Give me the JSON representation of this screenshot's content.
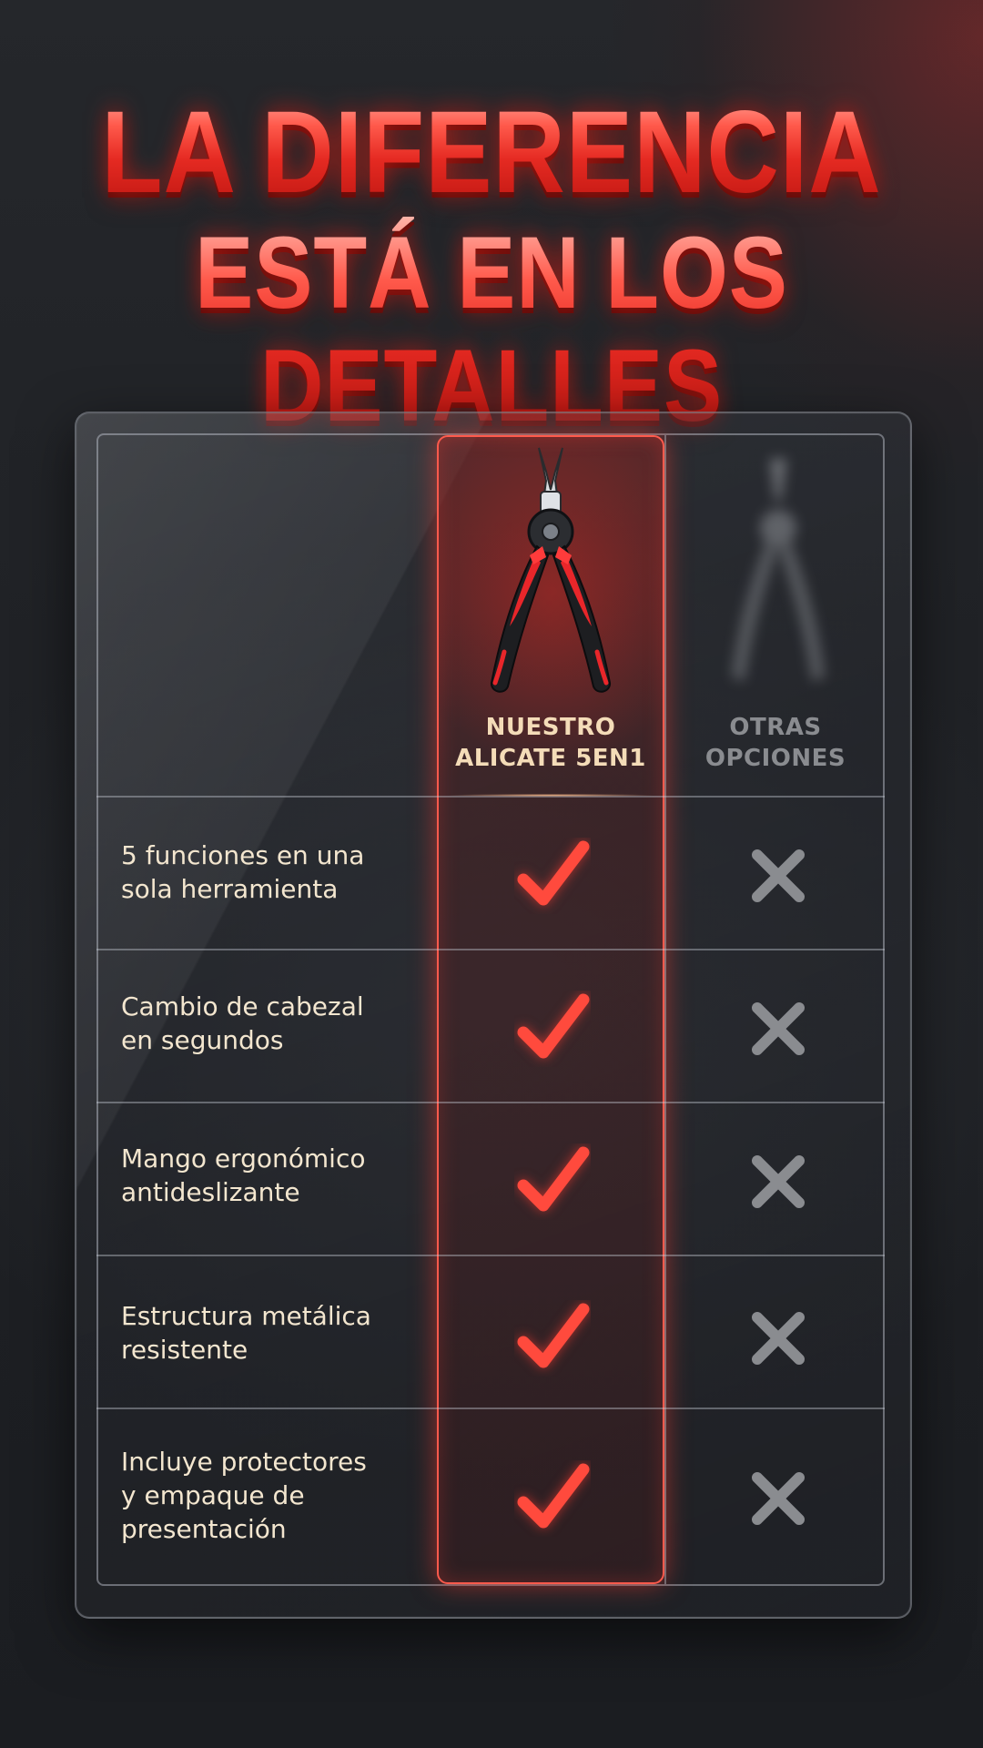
{
  "headline": {
    "line1": "LA DIFERENCIA",
    "line2": "ESTÁ EN LOS DETALLES"
  },
  "columns": {
    "ours": {
      "line1": "NUESTRO",
      "line2": "ALICATE 5EN1",
      "image_icon": "red-black-pliers-icon"
    },
    "others": {
      "line1": "OTRAS",
      "line2": "OPCIONES",
      "image_icon": "blurred-gray-pliers-icon"
    }
  },
  "rows": [
    {
      "lines": [
        "5 funciones en una",
        "sola herramienta"
      ],
      "ours": "check-icon",
      "others": "cross-icon"
    },
    {
      "lines": [
        "Cambio de cabezal",
        "en segundos"
      ],
      "ours": "check-icon",
      "others": "cross-icon"
    },
    {
      "lines": [
        "Mango ergonómico",
        "antideslizante"
      ],
      "ours": "check-icon",
      "others": "cross-icon"
    },
    {
      "lines": [
        "Estructura metálica",
        "resistente"
      ],
      "ours": "check-icon",
      "others": "cross-icon"
    },
    {
      "lines": [
        "Incluye protectores",
        "y empaque de",
        "presentación"
      ],
      "ours": "check-icon",
      "others": "cross-icon"
    }
  ],
  "colors": {
    "accent_red": "#ff4a3d",
    "label_cream": "#f3e6cf",
    "muted_gray": "#8a8c90",
    "background": "#1f2125"
  }
}
